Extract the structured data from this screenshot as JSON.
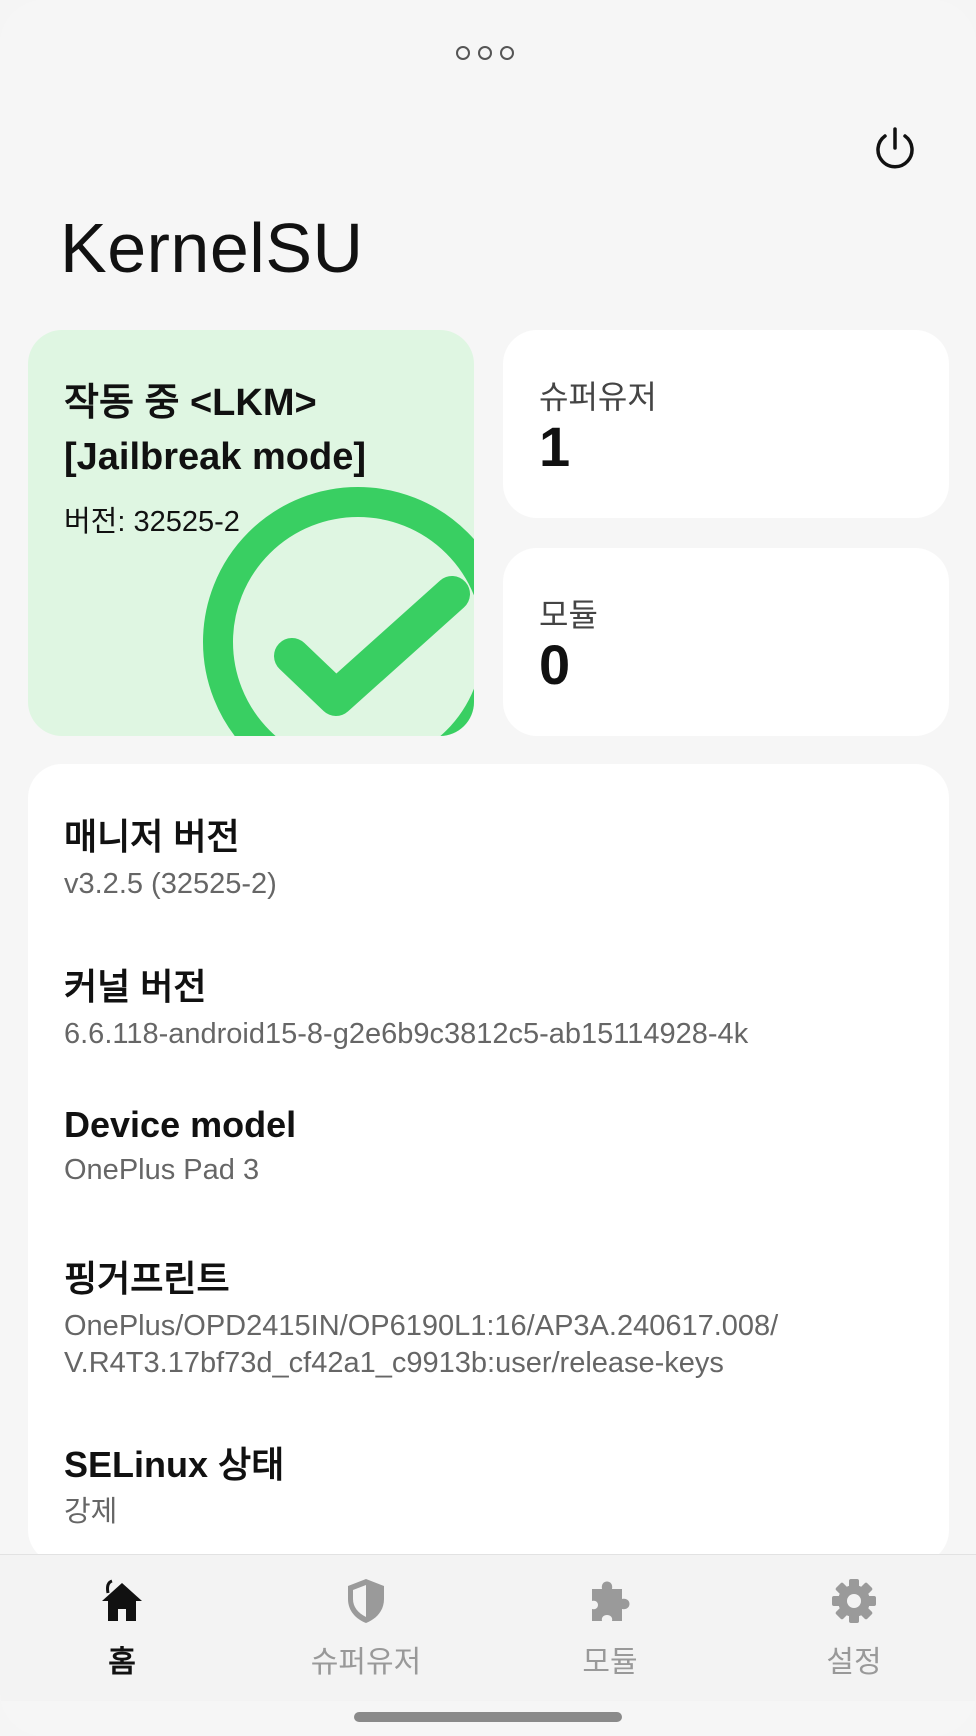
{
  "app": {
    "title": "KernelSU"
  },
  "status": {
    "title": "작동 중 <LKM>\n[Jailbreak mode]",
    "version": "버전: 32525-2",
    "color": "#2ecc5b"
  },
  "stats": {
    "superuser_label": "슈퍼유저",
    "superuser_value": "1",
    "module_label": "모듈",
    "module_value": "0"
  },
  "info": [
    {
      "label": "매니저 버전",
      "value": "v3.2.5 (32525-2)"
    },
    {
      "label": "커널 버전",
      "value": "6.6.118-android15-8-g2e6b9c3812c5-ab15114928-4k"
    },
    {
      "label": "Device model",
      "value": "OnePlus Pad 3"
    },
    {
      "label": "핑거프린트",
      "value": "OnePlus/OPD2415IN/OP6190L1:16/AP3A.240617.008/\nV.R4T3.17bf73d_cf42a1_c9913b:user/release-keys"
    },
    {
      "label": "SELinux 상태",
      "value": "강제"
    }
  ],
  "nav": [
    {
      "label": "홈",
      "icon": "home-icon",
      "active": true
    },
    {
      "label": "슈퍼유저",
      "icon": "shield-icon",
      "active": false
    },
    {
      "label": "모듈",
      "icon": "puzzle-icon",
      "active": false
    },
    {
      "label": "설정",
      "icon": "gear-icon",
      "active": false
    }
  ]
}
